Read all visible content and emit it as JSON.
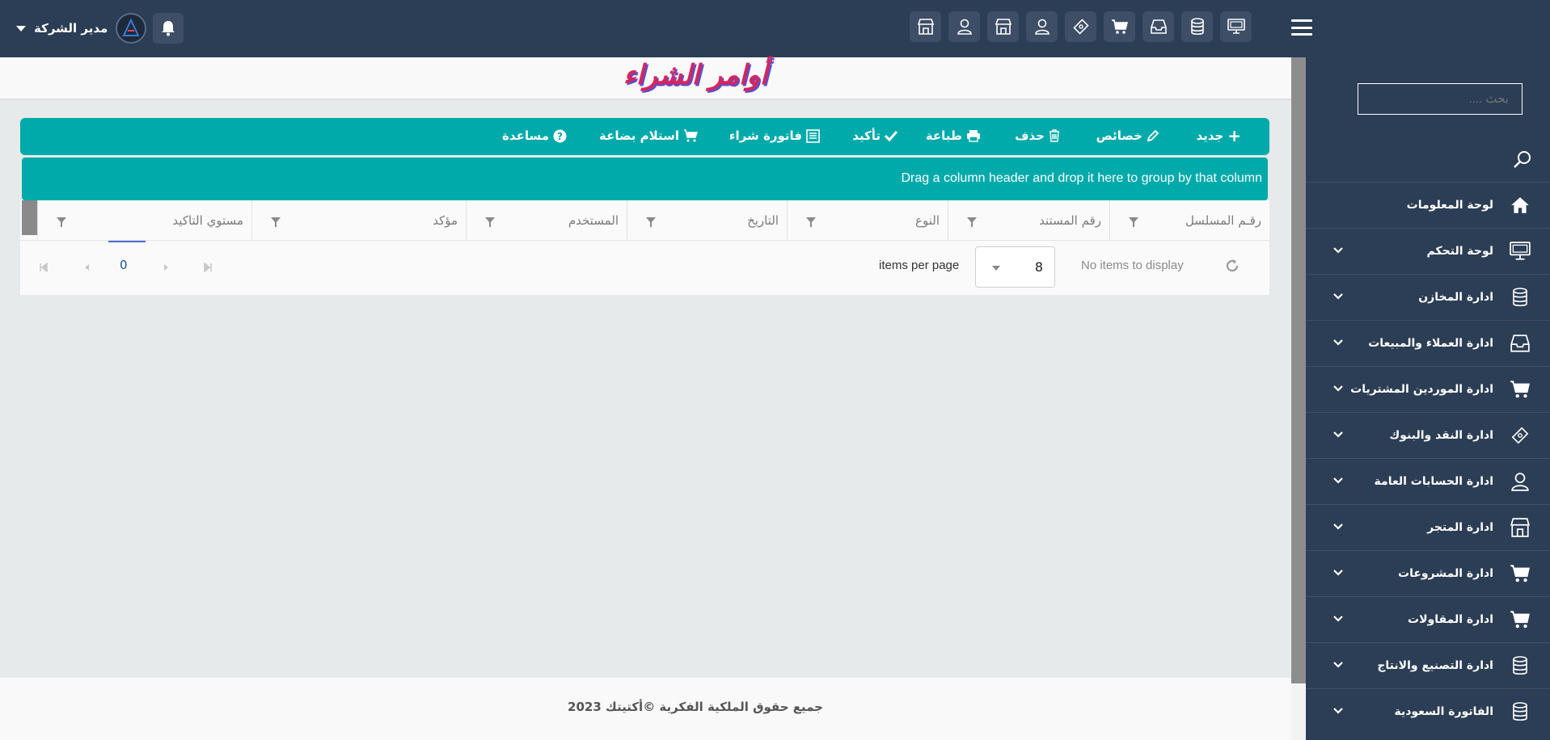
{
  "colors": {
    "topbar": "#2c3e55",
    "sidebar": "#2c3e55",
    "toolbar": "#00aaaa",
    "title": "#d6255e",
    "title_shadow": "#5a4fcf",
    "background": "#e6eaea"
  },
  "header": {
    "user_name": "مدير الشركة",
    "top_icons": [
      "monitor-icon",
      "database-icon",
      "inbox-icon",
      "cart-icon",
      "money-icon",
      "user-icon",
      "store-icon",
      "user-icon",
      "store-icon"
    ]
  },
  "sidebar": {
    "search_placeholder": "بحث ....",
    "items": [
      {
        "label": "لوحة المعلومات",
        "icon": "home-icon",
        "expandable": false
      },
      {
        "label": "لوحة التحكم",
        "icon": "monitor-icon",
        "expandable": true
      },
      {
        "label": "ادارة المخازن",
        "icon": "database-icon",
        "expandable": true
      },
      {
        "label": "ادارة العملاء والمبيعات",
        "icon": "inbox-icon",
        "expandable": true
      },
      {
        "label": "ادارة الموردين المشتريات",
        "icon": "cart-icon",
        "expandable": true
      },
      {
        "label": "ادارة النقد والبنوك",
        "icon": "money-icon",
        "expandable": true
      },
      {
        "label": "ادارة الحسابات العامة",
        "icon": "user-icon",
        "expandable": true
      },
      {
        "label": "ادارة المتجر",
        "icon": "store-icon",
        "expandable": true
      },
      {
        "label": "ادارة المشروعات",
        "icon": "cart-icon",
        "expandable": true
      },
      {
        "label": "ادارة المقاولات",
        "icon": "cart-icon",
        "expandable": true
      },
      {
        "label": "ادارة التصنيع والانتاج",
        "icon": "database-icon",
        "expandable": true
      },
      {
        "label": "الفاتورة السعودية",
        "icon": "database-icon",
        "expandable": true
      }
    ]
  },
  "page": {
    "title": "أوامر الشراء"
  },
  "toolbar": {
    "new": "جديد",
    "properties": "خصائص",
    "delete": "حذف",
    "print": "طباعة",
    "confirm": "تأكيد",
    "purchase_invoice": "فاتورة شراء",
    "receive_goods": "استلام بضاعة",
    "help": "مساعدة"
  },
  "grid": {
    "group_hint": "Drag a column header and drop it here to group by that column",
    "columns": [
      "رقـم المسلسل",
      "رقم المستند",
      "النوع",
      "التاريخ",
      "المستخدم",
      "مؤكد",
      "مستوي التاكيد"
    ],
    "no_items": "No items to display",
    "items_per_page_label": "items per page",
    "items_per_page": "8",
    "current_page": "0"
  },
  "footer": {
    "text": "جميع حقوق الملكية الفكرية ©أكتيتك 2023"
  }
}
